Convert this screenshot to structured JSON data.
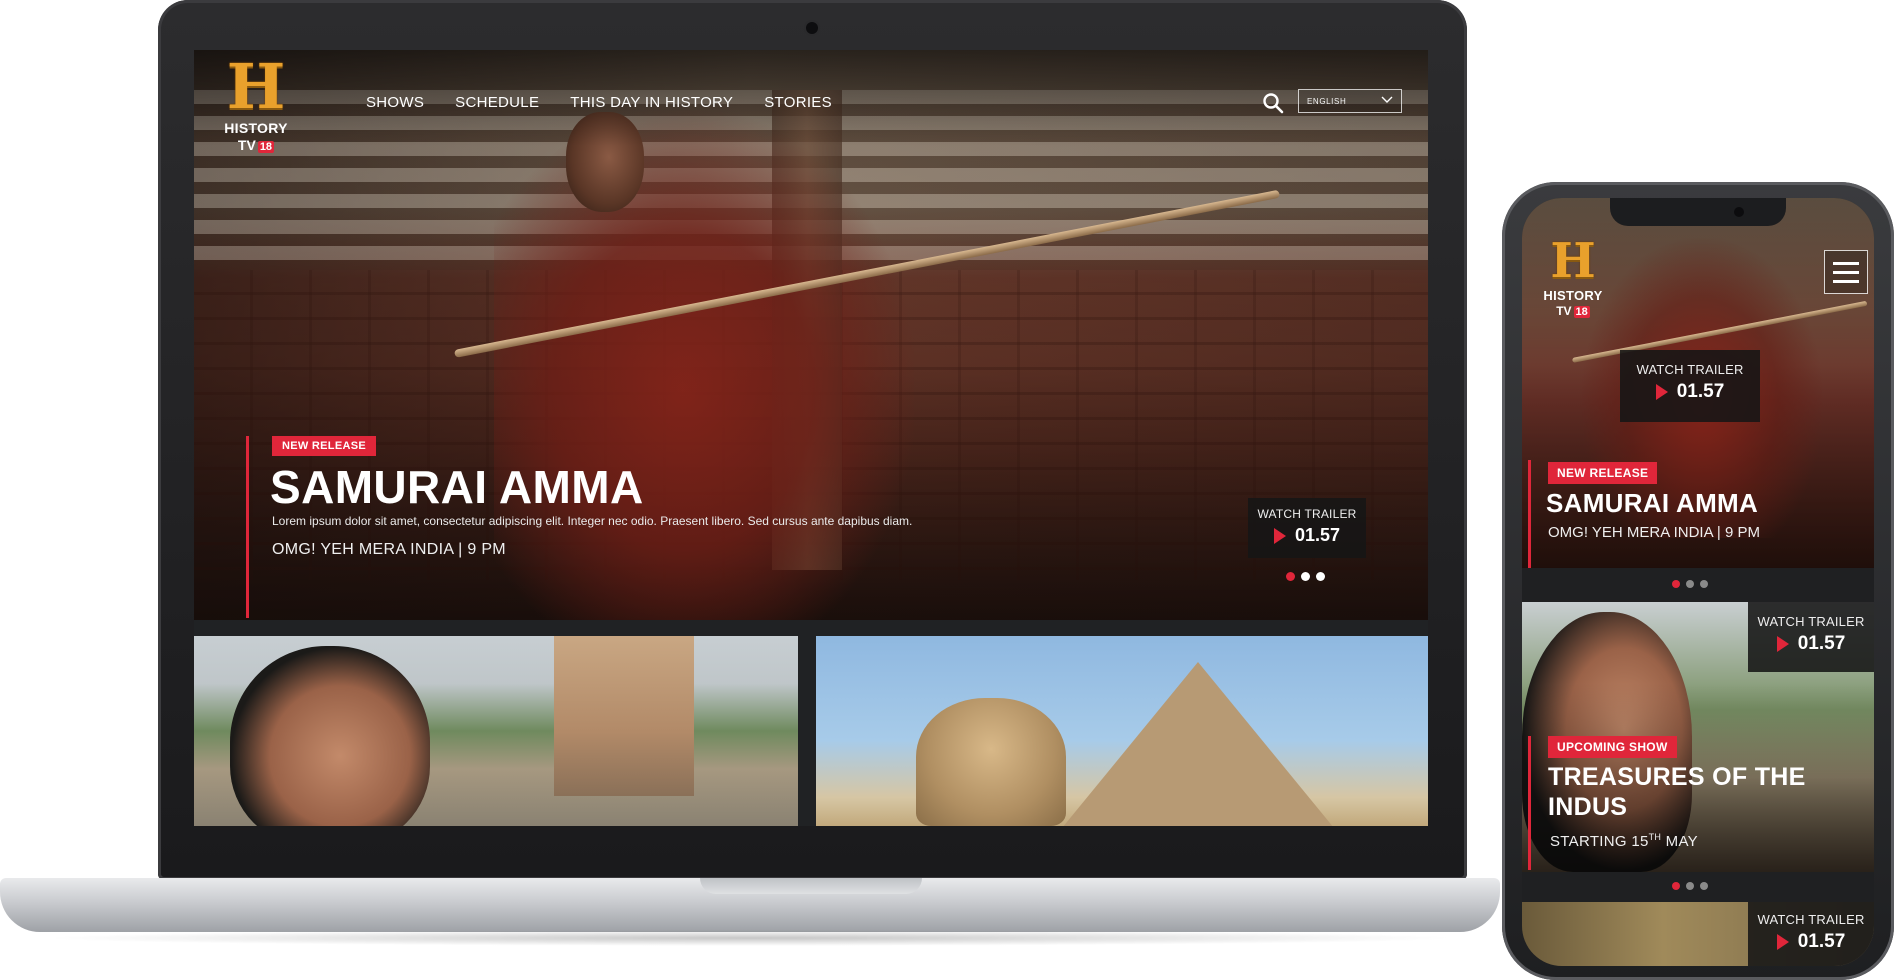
{
  "brand": {
    "logo_letter": "H",
    "logo_name": "HISTORY",
    "logo_tv": "TV",
    "logo_number": "18",
    "accent_color": "#e0263a",
    "logo_color": "#e9a12c"
  },
  "laptop": {
    "nav": {
      "links": [
        "SHOWS",
        "SCHEDULE",
        "THIS DAY IN HISTORY",
        "STORIES"
      ],
      "search_icon": "search-icon",
      "language": "ENGLISH",
      "language_icon": "chevron-down-icon"
    },
    "hero": {
      "badge": "NEW RELEASE",
      "title": "SAMURAI AMMA",
      "description": "Lorem ipsum dolor sit amet, consectetur adipiscing elit. Integer nec odio. Praesent libero. Sed cursus ante dapibus diam.",
      "schedule": "OMG! YEH MERA INDIA | 9 PM",
      "trailer_label": "WATCH TRAILER",
      "trailer_time": "01.57",
      "slides": 3,
      "active_slide": 1
    }
  },
  "phone": {
    "menu_icon": "hamburger-menu-icon",
    "hero": {
      "trailer_label": "WATCH TRAILER",
      "trailer_time": "01.57",
      "badge": "NEW RELEASE",
      "title": "SAMURAI AMMA",
      "schedule": "OMG! YEH MERA INDIA | 9 PM"
    },
    "card": {
      "trailer_label": "WATCH TRAILER",
      "trailer_time": "01.57",
      "badge": "UPCOMING SHOW",
      "title": "TREASURES OF THE INDUS",
      "date_prefix": "STARTING 15",
      "date_suffix": "TH",
      "date_month": " MAY"
    },
    "card3": {
      "trailer_label": "WATCH TRAILER",
      "trailer_time": "01.57"
    }
  }
}
